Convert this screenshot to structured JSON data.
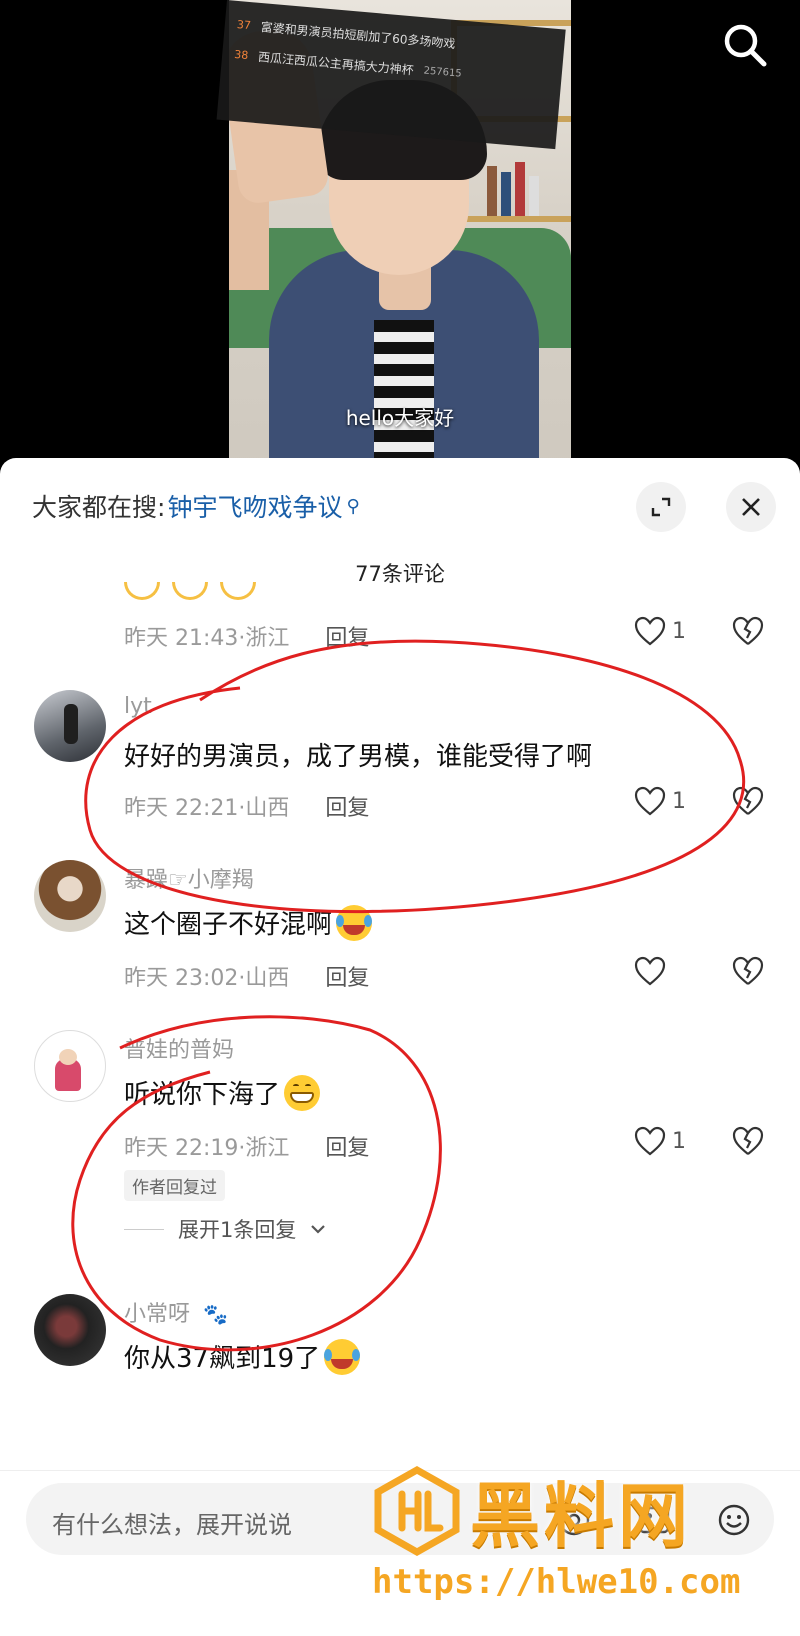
{
  "video": {
    "subtitle": "hello大家好",
    "trending": [
      {
        "rank": "37",
        "text": "富婆和男演员拍短剧加了60多场吻戏",
        "heat": ""
      },
      {
        "rank": "38",
        "text": "西瓜汪西瓜公主再搞大力神杯",
        "heat": "257615"
      }
    ],
    "search_icon": "search-icon"
  },
  "panel": {
    "search_prefix": "大家都在搜:",
    "search_term": "钟宇飞吻戏争议",
    "expand_icon": "expand-icon",
    "close_icon": "close-icon",
    "count": "77条评论"
  },
  "comments": [
    {
      "username": "",
      "text": "",
      "time": "昨天 21:43·浙江",
      "reply": "回复",
      "likes": "1"
    },
    {
      "username": "lyt",
      "text": "好好的男演员，成了男模，谁能受得了啊",
      "time": "昨天 22:21·山西",
      "reply": "回复",
      "likes": "1"
    },
    {
      "username": "暴躁☞小摩羯",
      "text": "这个圈子不好混啊",
      "time": "昨天 23:02·山西",
      "reply": "回复",
      "likes": ""
    },
    {
      "username": "普娃的普妈",
      "text": "听说你下海了",
      "time": "昨天 22:19·浙江",
      "reply": "回复",
      "likes": "1",
      "badge": "作者回复过",
      "expand": "展开1条回复"
    },
    {
      "username": "小常呀",
      "text": "你从37飙到19了"
    }
  ],
  "input": {
    "placeholder": "有什么想法，展开说说"
  },
  "watermark": {
    "title": "黑料网",
    "url": "https://hlwe10.com"
  },
  "colors": {
    "link": "#1a5fa8",
    "annotation": "#e02020",
    "watermark": "#f5a623"
  }
}
